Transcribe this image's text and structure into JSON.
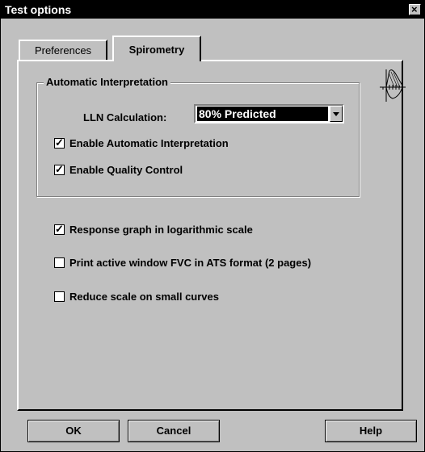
{
  "window": {
    "title": "Test options",
    "close_label": "×"
  },
  "tabs": [
    {
      "label": "Preferences",
      "selected": false
    },
    {
      "label": "Spirometry",
      "selected": true
    }
  ],
  "group": {
    "title": "Automatic Interpretation",
    "lln_label": "LLN Calculation:",
    "lln_value": "80% Predicted",
    "enable_auto_interp": {
      "label": "Enable Automatic Interpretation",
      "checked": true
    },
    "enable_quality_control": {
      "label": "Enable Quality Control",
      "checked": true
    }
  },
  "options": {
    "response_log": {
      "label": "Response graph in logarithmic scale",
      "checked": true
    },
    "print_ats": {
      "label": "Print active window FVC in ATS format (2 pages)",
      "checked": false
    },
    "reduce_scale": {
      "label": "Reduce scale on small curves",
      "checked": false
    }
  },
  "icon": {
    "name": "spirometry-curve-icon"
  },
  "buttons": {
    "ok": "OK",
    "cancel": "Cancel",
    "help": "Help"
  }
}
